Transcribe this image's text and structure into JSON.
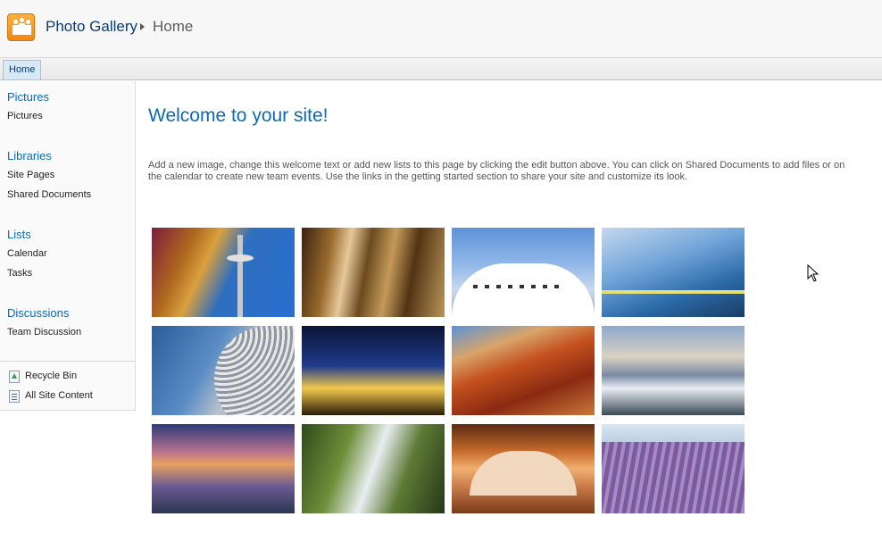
{
  "header": {
    "logo_icon": "photo-gallery-logo-icon",
    "site_title": "Photo Gallery",
    "breadcrumb_separator_icon": "breadcrumb-arrow-icon",
    "breadcrumb_current": "Home"
  },
  "topnav": {
    "tabs": [
      {
        "label": "Home",
        "selected": true
      }
    ]
  },
  "leftnav": {
    "sections": [
      {
        "heading": "Pictures",
        "items": [
          "Pictures"
        ]
      },
      {
        "heading": "Libraries",
        "items": [
          "Site Pages",
          "Shared Documents"
        ]
      },
      {
        "heading": "Lists",
        "items": [
          "Calendar",
          "Tasks"
        ]
      },
      {
        "heading": "Discussions",
        "items": [
          "Team Discussion"
        ]
      }
    ],
    "footer_links": [
      {
        "label": "Recycle Bin",
        "icon": "recycle-bin-icon"
      },
      {
        "label": "All Site Content",
        "icon": "all-site-content-icon"
      }
    ]
  },
  "main": {
    "title": "Welcome to your site!",
    "description": "Add a new image, change this welcome text or add new lists to this page by clicking the edit button above. You can click on Shared Documents to add files or on the calendar to create new team events. Use the links in the getting started section to share your site and customize its look.",
    "gallery_count": 12
  },
  "colors": {
    "accent": "#0b6ab4",
    "title_dark": "#0b3b73",
    "logo_orange": "#f08a14"
  }
}
